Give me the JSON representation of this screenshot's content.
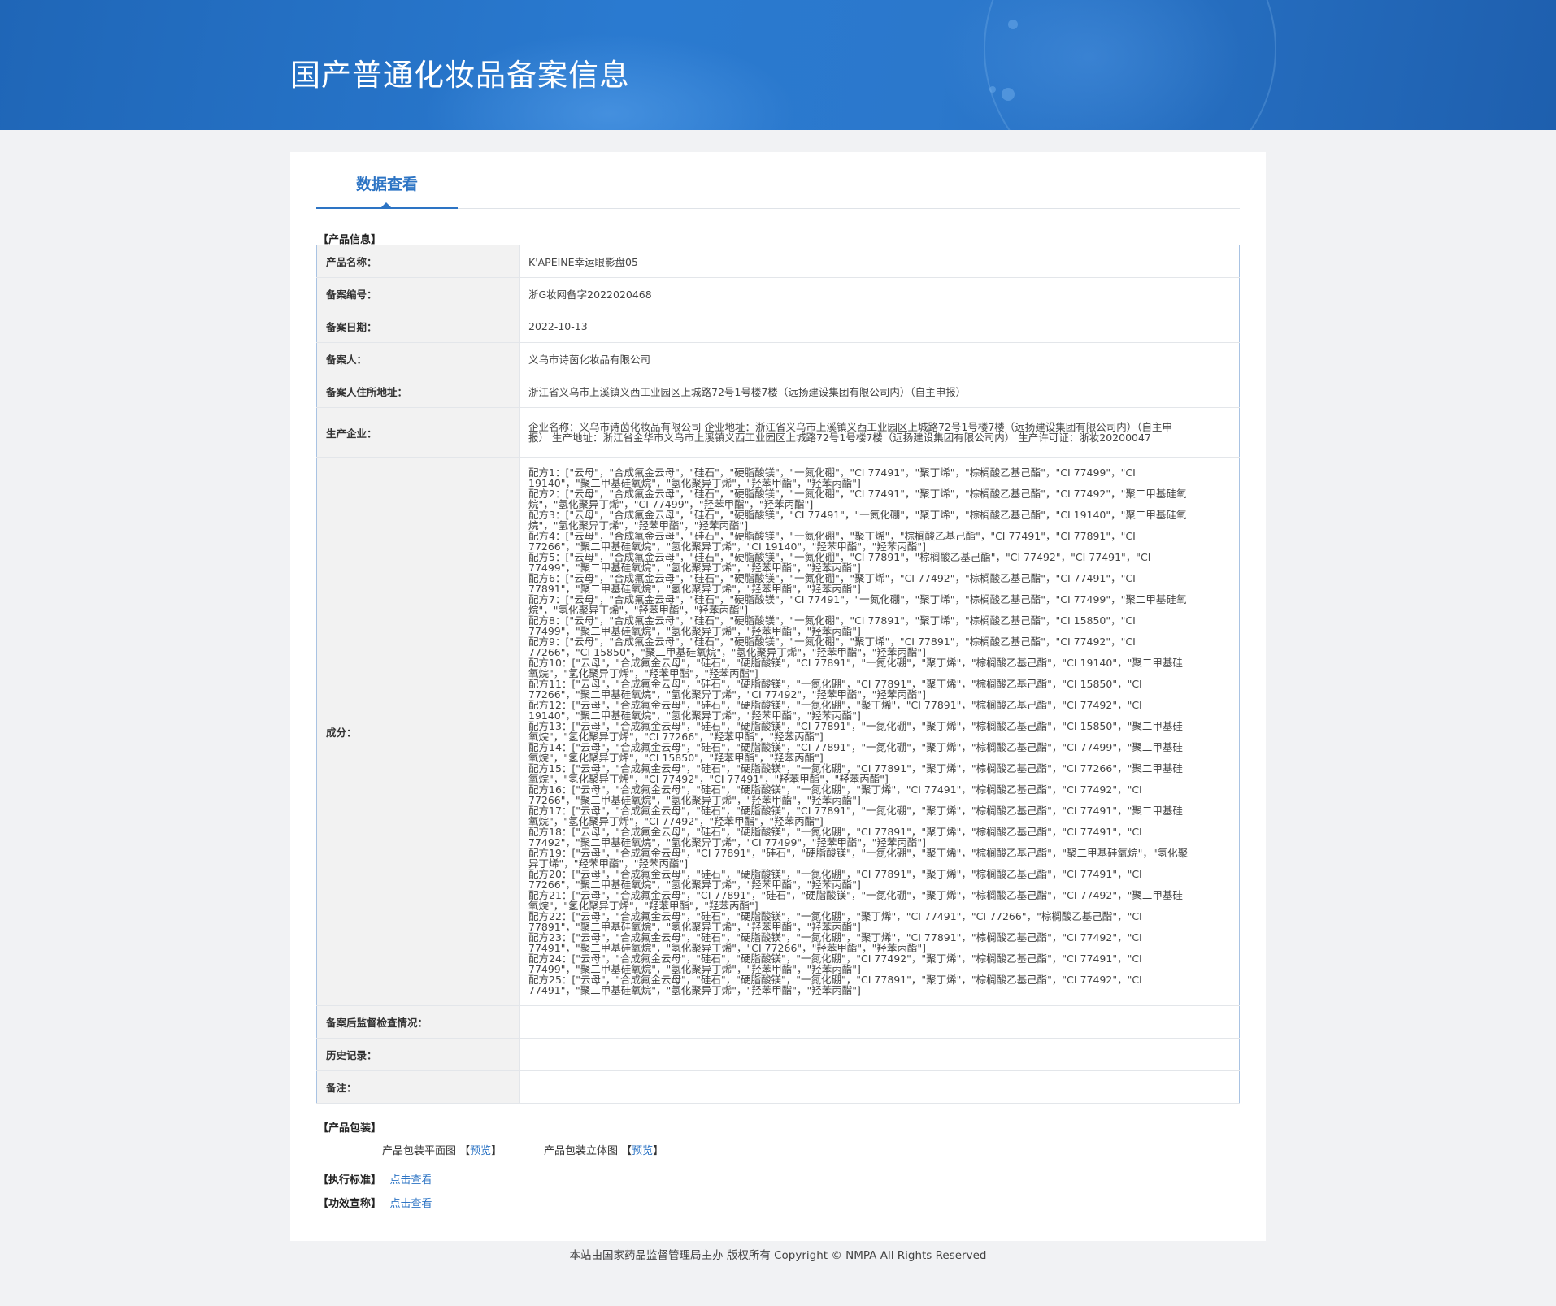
{
  "header": {
    "title": "国产普通化妆品备案信息"
  },
  "tabs": [
    {
      "label": "数据查看"
    }
  ],
  "sections": {
    "product_info": "【产品信息】",
    "packaging": "【产品包装】",
    "standard": "【执行标准】",
    "claims": "【功效宣称】"
  },
  "product": {
    "rows": [
      {
        "key": "产品名称：",
        "value": "K'APEINE幸运眼影盘05"
      },
      {
        "key": "备案编号：",
        "value": "浙G妆网备字2022020468"
      },
      {
        "key": "备案日期：",
        "value": "2022-10-13"
      },
      {
        "key": "备案人：",
        "value": "义乌市诗茵化妆品有限公司"
      },
      {
        "key": "备案人住所地址：",
        "value": "浙江省义乌市上溪镇义西工业园区上城路72号1号楼7楼（远扬建设集团有限公司内）（自主申报）"
      },
      {
        "key": "生产企业：",
        "value": "企业名称：义乌市诗茵化妆品有限公司 企业地址：浙江省义乌市上溪镇义西工业园区上城路72号1号楼7楼（远扬建设集团有限公司内）（自主申报） 生产地址：浙江省金华市义乌市上溪镇义西工业园区上城路72号1号楼7楼（远扬建设集团有限公司内） 生产许可证：浙妆20200047"
      }
    ],
    "ingredients_key": "成分：",
    "ingredients": [
      "配方1：[\"云母\"，\"合成氟金云母\"，\"硅石\"，\"硬脂酸镁\"，\"一氮化硼\"，\"CI 77491\"，\"聚丁烯\"，\"棕榈酸乙基己酯\"，\"CI 77499\"，\"CI 19140\"，\"聚二甲基硅氧烷\"，\"氢化聚异丁烯\"，\"羟苯甲酯\"，\"羟苯丙酯\"]",
      "配方2：[\"云母\"，\"合成氟金云母\"，\"硅石\"，\"硬脂酸镁\"，\"一氮化硼\"，\"CI 77491\"，\"聚丁烯\"，\"棕榈酸乙基己酯\"，\"CI 77492\"，\"聚二甲基硅氧烷\"，\"氢化聚异丁烯\"，\"CI 77499\"，\"羟苯甲酯\"，\"羟苯丙酯\"]",
      "配方3：[\"云母\"，\"合成氟金云母\"，\"硅石\"，\"硬脂酸镁\"，\"CI 77491\"，\"一氮化硼\"，\"聚丁烯\"，\"棕榈酸乙基己酯\"，\"CI 19140\"，\"聚二甲基硅氧烷\"，\"氢化聚异丁烯\"，\"羟苯甲酯\"，\"羟苯丙酯\"]",
      "配方4：[\"云母\"，\"合成氟金云母\"，\"硅石\"，\"硬脂酸镁\"，\"一氮化硼\"，\"聚丁烯\"，\"棕榈酸乙基己酯\"，\"CI 77491\"，\"CI 77891\"，\"CI 77266\"，\"聚二甲基硅氧烷\"，\"氢化聚异丁烯\"，\"CI 19140\"，\"羟苯甲酯\"，\"羟苯丙酯\"]",
      "配方5：[\"云母\"，\"合成氟金云母\"，\"硅石\"，\"硬脂酸镁\"，\"一氮化硼\"，\"CI 77891\"，\"棕榈酸乙基己酯\"，\"CI 77492\"，\"CI 77491\"，\"CI 77499\"，\"聚二甲基硅氧烷\"，\"氢化聚异丁烯\"，\"羟苯甲酯\"，\"羟苯丙酯\"]",
      "配方6：[\"云母\"，\"合成氟金云母\"，\"硅石\"，\"硬脂酸镁\"，\"一氮化硼\"，\"聚丁烯\"，\"CI 77492\"，\"棕榈酸乙基己酯\"，\"CI 77491\"，\"CI 77891\"，\"聚二甲基硅氧烷\"，\"氢化聚异丁烯\"，\"羟苯甲酯\"，\"羟苯丙酯\"]",
      "配方7：[\"云母\"，\"合成氟金云母\"，\"硅石\"，\"硬脂酸镁\"，\"CI 77491\"，\"一氮化硼\"，\"聚丁烯\"，\"棕榈酸乙基己酯\"，\"CI 77499\"，\"聚二甲基硅氧烷\"，\"氢化聚异丁烯\"，\"羟苯甲酯\"，\"羟苯丙酯\"]",
      "配方8：[\"云母\"，\"合成氟金云母\"，\"硅石\"，\"硬脂酸镁\"，\"一氮化硼\"，\"CI 77891\"，\"聚丁烯\"，\"棕榈酸乙基己酯\"，\"CI 15850\"，\"CI 77499\"，\"聚二甲基硅氧烷\"，\"氢化聚异丁烯\"，\"羟苯甲酯\"，\"羟苯丙酯\"]",
      "配方9：[\"云母\"，\"合成氟金云母\"，\"硅石\"，\"硬脂酸镁\"，\"一氮化硼\"，\"聚丁烯\"，\"CI 77891\"，\"棕榈酸乙基己酯\"，\"CI 77492\"，\"CI 77266\"，\"CI 15850\"，\"聚二甲基硅氧烷\"，\"氢化聚异丁烯\"，\"羟苯甲酯\"，\"羟苯丙酯\"]",
      "配方10：[\"云母\"，\"合成氟金云母\"，\"硅石\"，\"硬脂酸镁\"，\"CI 77891\"，\"一氮化硼\"，\"聚丁烯\"，\"棕榈酸乙基己酯\"，\"CI 19140\"，\"聚二甲基硅氧烷\"，\"氢化聚异丁烯\"，\"羟苯甲酯\"，\"羟苯丙酯\"]",
      "配方11：[\"云母\"，\"合成氟金云母\"，\"硅石\"，\"硬脂酸镁\"，\"一氮化硼\"，\"CI 77891\"，\"聚丁烯\"，\"棕榈酸乙基己酯\"，\"CI 15850\"，\"CI 77266\"，\"聚二甲基硅氧烷\"，\"氢化聚异丁烯\"，\"CI 77492\"，\"羟苯甲酯\"，\"羟苯丙酯\"]",
      "配方12：[\"云母\"，\"合成氟金云母\"，\"硅石\"，\"硬脂酸镁\"，\"一氮化硼\"，\"聚丁烯\"，\"CI 77891\"，\"棕榈酸乙基己酯\"，\"CI 77492\"，\"CI 19140\"，\"聚二甲基硅氧烷\"，\"氢化聚异丁烯\"，\"羟苯甲酯\"，\"羟苯丙酯\"]",
      "配方13：[\"云母\"，\"合成氟金云母\"，\"硅石\"，\"硬脂酸镁\"，\"CI 77891\"，\"一氮化硼\"，\"聚丁烯\"，\"棕榈酸乙基己酯\"，\"CI 15850\"，\"聚二甲基硅氧烷\"，\"氢化聚异丁烯\"，\"CI 77266\"，\"羟苯甲酯\"，\"羟苯丙酯\"]",
      "配方14：[\"云母\"，\"合成氟金云母\"，\"硅石\"，\"硬脂酸镁\"，\"CI 77891\"，\"一氮化硼\"，\"聚丁烯\"，\"棕榈酸乙基己酯\"，\"CI 77499\"，\"聚二甲基硅氧烷\"，\"氢化聚异丁烯\"，\"CI 15850\"，\"羟苯甲酯\"，\"羟苯丙酯\"]",
      "配方15：[\"云母\"，\"合成氟金云母\"，\"硅石\"，\"硬脂酸镁\"，\"一氮化硼\"，\"CI 77891\"，\"聚丁烯\"，\"棕榈酸乙基己酯\"，\"CI 77266\"，\"聚二甲基硅氧烷\"，\"氢化聚异丁烯\"，\"CI 77492\"，\"CI 77491\"，\"羟苯甲酯\"，\"羟苯丙酯\"]",
      "配方16：[\"云母\"，\"合成氟金云母\"，\"硅石\"，\"硬脂酸镁\"，\"一氮化硼\"，\"聚丁烯\"，\"CI 77491\"，\"棕榈酸乙基己酯\"，\"CI 77492\"，\"CI 77266\"，\"聚二甲基硅氧烷\"，\"氢化聚异丁烯\"，\"羟苯甲酯\"，\"羟苯丙酯\"]",
      "配方17：[\"云母\"，\"合成氟金云母\"，\"硅石\"，\"硬脂酸镁\"，\"CI 77891\"，\"一氮化硼\"，\"聚丁烯\"，\"棕榈酸乙基己酯\"，\"CI 77491\"，\"聚二甲基硅氧烷\"，\"氢化聚异丁烯\"，\"CI 77492\"，\"羟苯甲酯\"，\"羟苯丙酯\"]",
      "配方18：[\"云母\"，\"合成氟金云母\"，\"硅石\"，\"硬脂酸镁\"，\"一氮化硼\"，\"CI 77891\"，\"聚丁烯\"，\"棕榈酸乙基己酯\"，\"CI 77491\"，\"CI 77492\"，\"聚二甲基硅氧烷\"，\"氢化聚异丁烯\"，\"CI 77499\"，\"羟苯甲酯\"，\"羟苯丙酯\"]",
      "配方19：[\"云母\"，\"合成氟金云母\"，\"CI 77891\"，\"硅石\"，\"硬脂酸镁\"，\"一氮化硼\"，\"聚丁烯\"，\"棕榈酸乙基己酯\"，\"聚二甲基硅氧烷\"，\"氢化聚异丁烯\"，\"羟苯甲酯\"，\"羟苯丙酯\"]",
      "配方20：[\"云母\"，\"合成氟金云母\"，\"硅石\"，\"硬脂酸镁\"，\"一氮化硼\"，\"CI 77891\"，\"聚丁烯\"，\"棕榈酸乙基己酯\"，\"CI 77491\"，\"CI 77266\"，\"聚二甲基硅氧烷\"，\"氢化聚异丁烯\"，\"羟苯甲酯\"，\"羟苯丙酯\"]",
      "配方21：[\"云母\"，\"合成氟金云母\"，\"CI 77891\"，\"硅石\"，\"硬脂酸镁\"，\"一氮化硼\"，\"聚丁烯\"，\"棕榈酸乙基己酯\"，\"CI 77492\"，\"聚二甲基硅氧烷\"，\"氢化聚异丁烯\"，\"羟苯甲酯\"，\"羟苯丙酯\"]",
      "配方22：[\"云母\"，\"合成氟金云母\"，\"硅石\"，\"硬脂酸镁\"，\"一氮化硼\"，\"聚丁烯\"，\"CI 77491\"，\"CI 77266\"，\"棕榈酸乙基己酯\"，\"CI 77891\"，\"聚二甲基硅氧烷\"，\"氢化聚异丁烯\"，\"羟苯甲酯\"，\"羟苯丙酯\"]",
      "配方23：[\"云母\"，\"合成氟金云母\"，\"硅石\"，\"硬脂酸镁\"，\"一氮化硼\"，\"聚丁烯\"，\"CI 77891\"，\"棕榈酸乙基己酯\"，\"CI 77492\"，\"CI 77491\"，\"聚二甲基硅氧烷\"，\"氢化聚异丁烯\"，\"CI 77266\"，\"羟苯甲酯\"，\"羟苯丙酯\"]",
      "配方24：[\"云母\"，\"合成氟金云母\"，\"硅石\"，\"硬脂酸镁\"，\"一氮化硼\"，\"CI 77492\"，\"聚丁烯\"，\"棕榈酸乙基己酯\"，\"CI 77491\"，\"CI 77499\"，\"聚二甲基硅氧烷\"，\"氢化聚异丁烯\"，\"羟苯甲酯\"，\"羟苯丙酯\"]",
      "配方25：[\"云母\"，\"合成氟金云母\"，\"硅石\"，\"硬脂酸镁\"，\"一氮化硼\"，\"CI 77891\"，\"聚丁烯\"，\"棕榈酸乙基己酯\"，\"CI 77492\"，\"CI 77491\"，\"聚二甲基硅氧烷\"，\"氢化聚异丁烯\"，\"羟苯甲酯\"，\"羟苯丙酯\"]"
    ],
    "tail_rows": [
      {
        "key": "备案后监督检查情况：",
        "value": ""
      },
      {
        "key": "历史记录：",
        "value": ""
      },
      {
        "key": "备注：",
        "value": ""
      }
    ]
  },
  "packaging": {
    "flat_label": "产品包装平面图",
    "solid_label": "产品包装立体图",
    "preview_open": "【",
    "preview_link": "预览",
    "preview_close": "】"
  },
  "links": {
    "standard_link": "点击查看",
    "claims_link": "点击查看"
  },
  "footer": {
    "text": "本站由国家药品监督管理局主办 版权所有 Copyright © NMPA All Rights Reserved"
  },
  "colors": {
    "accent": "#2d74c4",
    "banner": "#2a7ad0",
    "border": "#a9c3e3"
  }
}
